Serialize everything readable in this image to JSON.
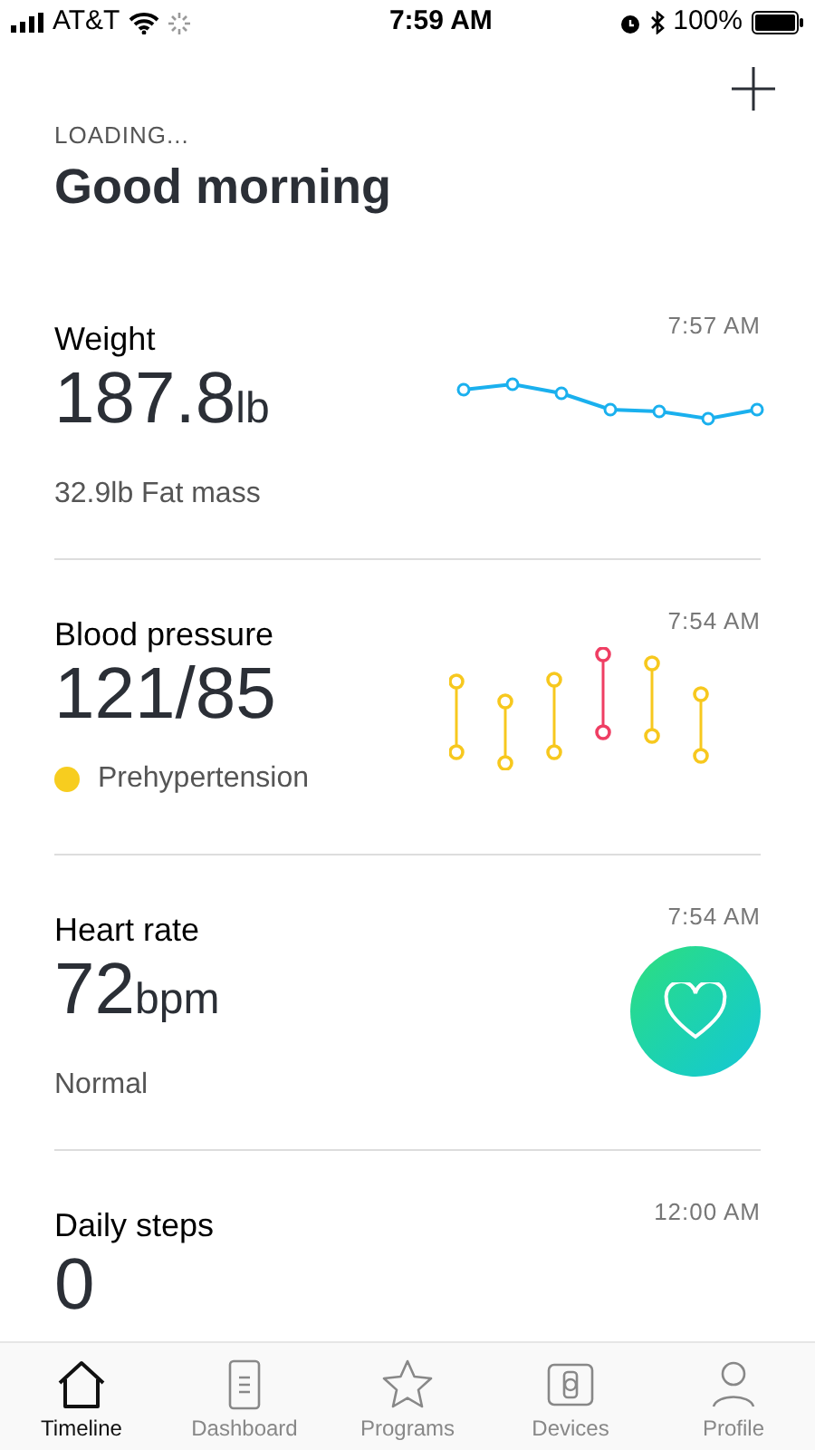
{
  "status_bar": {
    "carrier": "AT&T",
    "time": "7:59 AM",
    "battery": "100%"
  },
  "header": {
    "eyebrow": "LOADING...",
    "title": "Good morning"
  },
  "cards": [
    {
      "kind": "sparkline",
      "title": "Weight",
      "time": "7:57 AM",
      "value": "187.8",
      "unit": "lb",
      "subtitle": "32.9lb Fat mass"
    },
    {
      "kind": "ranges",
      "title": "Blood pressure",
      "time": "7:54 AM",
      "value": "121/85",
      "subtitle": "Prehypertension",
      "color": "#f7cd1f"
    },
    {
      "kind": "heart",
      "title": "Heart rate",
      "time": "7:54 AM",
      "value": "72",
      "unit": "bpm",
      "subtitle": "Normal"
    },
    {
      "kind": "plain",
      "title": "Daily steps",
      "time": "12:00 AM",
      "value": "0"
    }
  ],
  "tabs": [
    {
      "kind": "home",
      "label": "Timeline",
      "selected": true
    },
    {
      "kind": "document",
      "label": "Dashboard",
      "selected": false
    },
    {
      "kind": "star",
      "label": "Programs",
      "selected": false
    },
    {
      "kind": "watch",
      "label": "Devices",
      "selected": false
    },
    {
      "kind": "person",
      "label": "Profile",
      "selected": false
    }
  ]
}
